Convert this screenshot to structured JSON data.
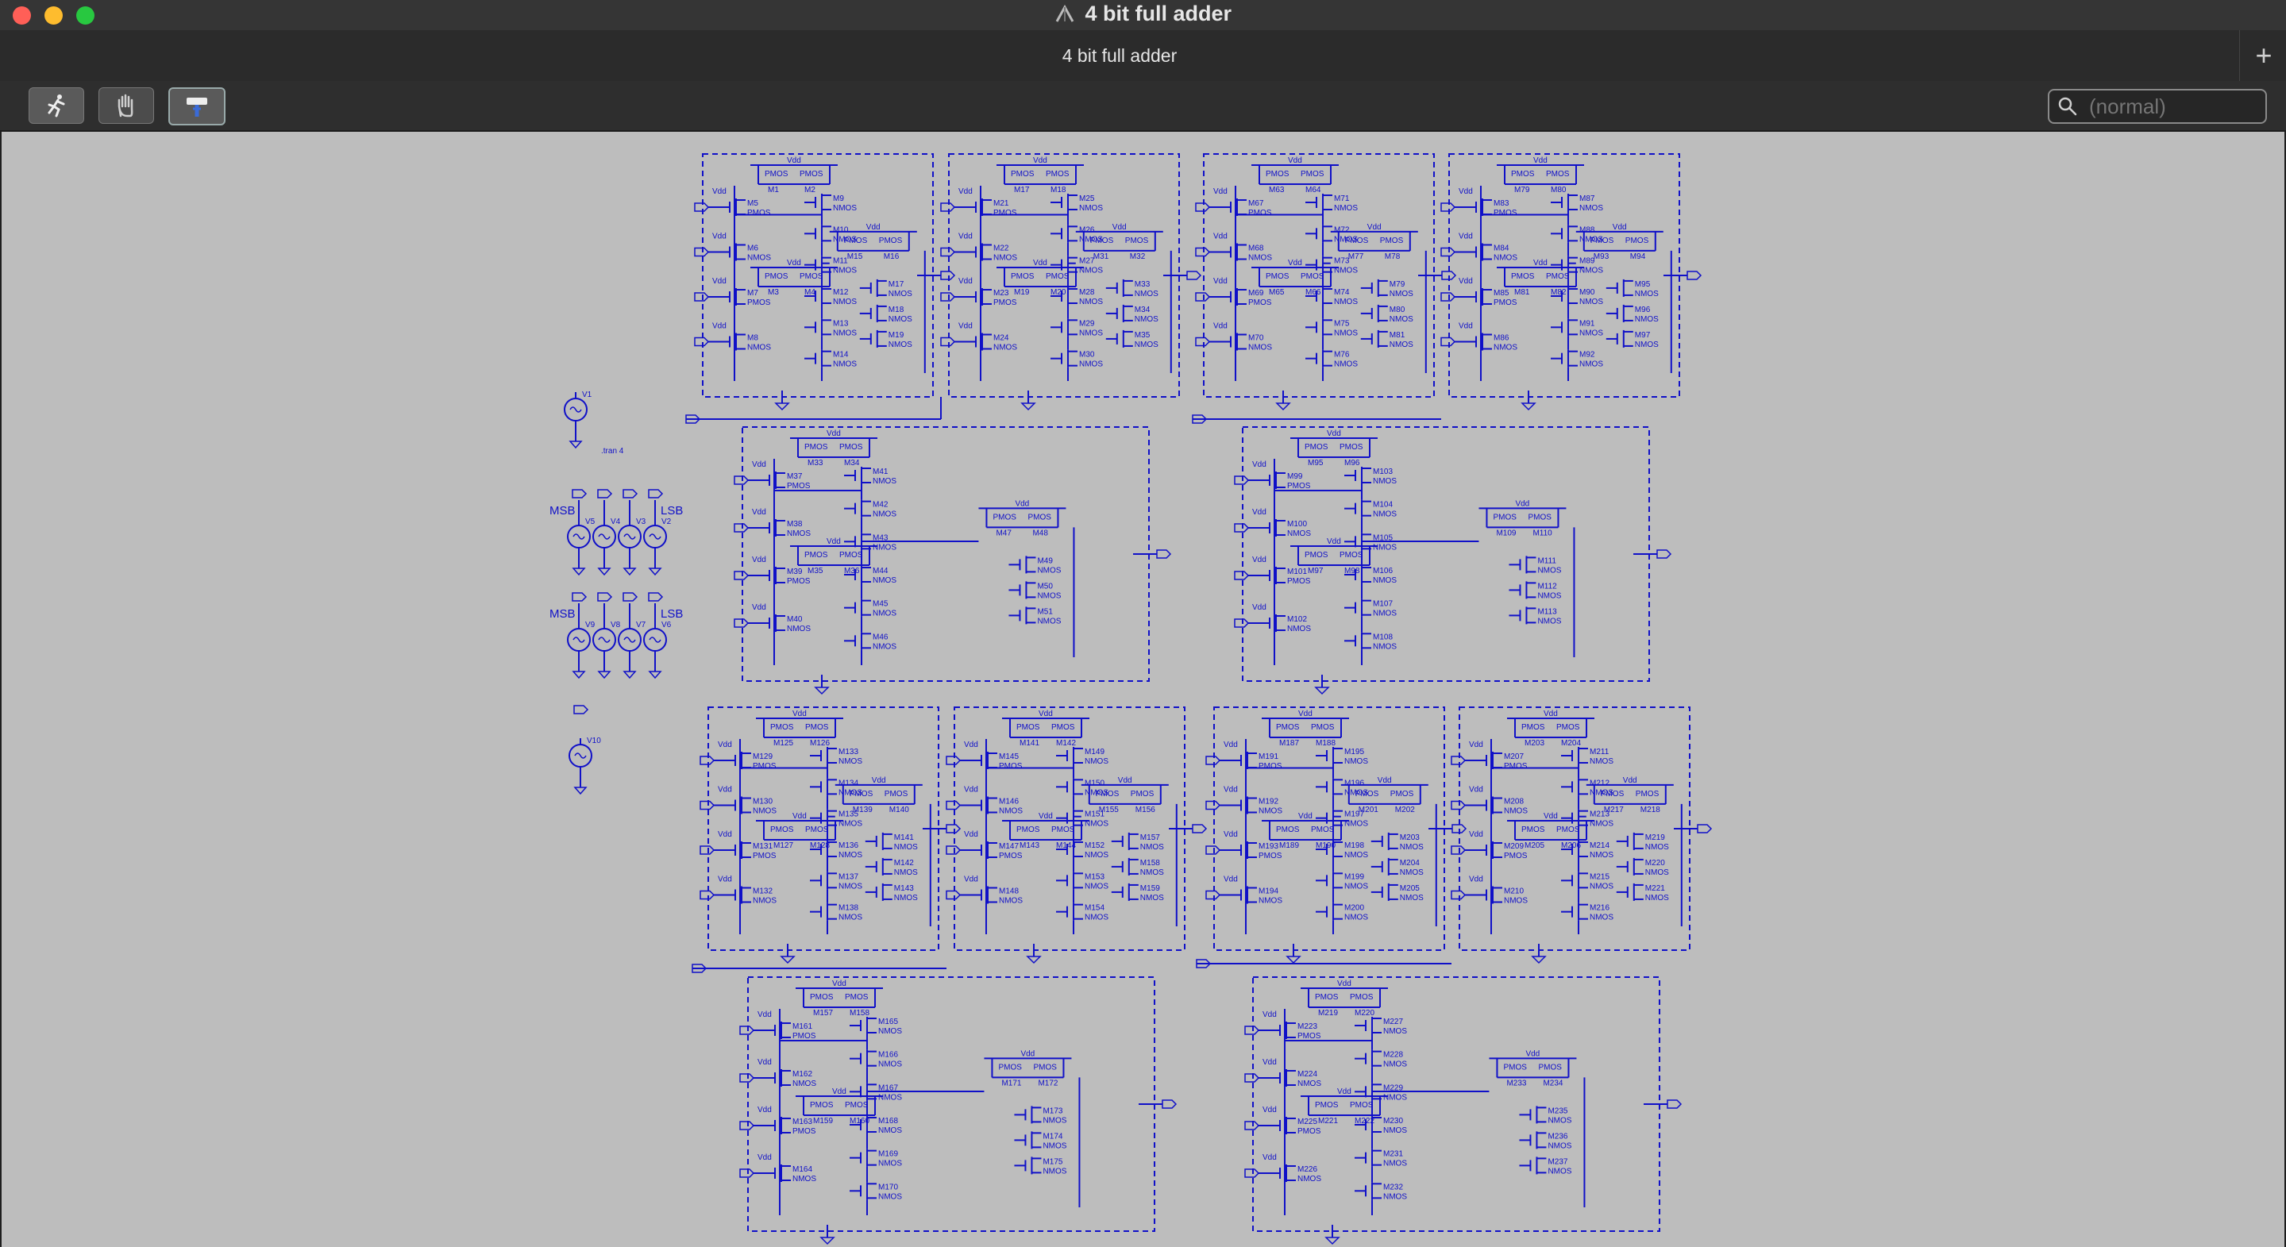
{
  "window": {
    "title": "4 bit full adder"
  },
  "tabs": [
    {
      "label": "4 bit full adder"
    }
  ],
  "tab_add_label": "+",
  "toolbar": {
    "buttons": [
      "run-simulation",
      "pan-hand",
      "probe"
    ]
  },
  "search": {
    "placeholder": "(normal)"
  },
  "schematic": {
    "directive": ".tran 4",
    "sources": {
      "v1": "V1",
      "v10": "V10"
    },
    "input_groups": [
      {
        "msb": "MSB",
        "lsb": "LSB",
        "names": [
          "V5",
          "V4",
          "V3",
          "V2"
        ]
      },
      {
        "msb": "MSB",
        "lsb": "LSB",
        "names": [
          "V9",
          "V8",
          "V7",
          "V6"
        ]
      }
    ],
    "net_vdd": "Vdd",
    "device_pmos": "PMOS",
    "device_nmos": "NMOS",
    "row_blocks": [
      [
        "M1",
        "M17",
        "M63",
        "M79"
      ],
      [
        "M33",
        "M95"
      ],
      [
        "M125",
        "M141",
        "M187",
        "M203"
      ],
      [
        "M157",
        "M219"
      ]
    ]
  },
  "colors": {
    "wire": "#1010c8",
    "canvas": "#bdbdbd",
    "chrome": "#353535"
  }
}
